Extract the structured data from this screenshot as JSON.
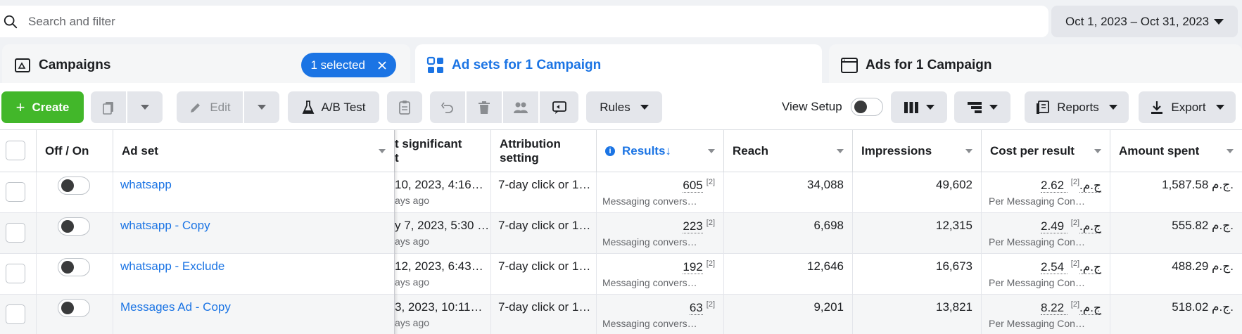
{
  "search": {
    "placeholder": "Search and filter"
  },
  "date_range": {
    "label": "Oct 1, 2023 – Oct 31, 2023"
  },
  "tabs": {
    "campaigns": {
      "label": "Campaigns",
      "selected_label": "1 selected"
    },
    "adsets": {
      "label": "Ad sets for 1 Campaign"
    },
    "ads": {
      "label": "Ads for 1 Campaign"
    }
  },
  "toolbar": {
    "create_label": "Create",
    "edit_label": "Edit",
    "abtest_label": "A/B Test",
    "rules_label": "Rules",
    "view_setup_label": "View Setup",
    "reports_label": "Reports",
    "export_label": "Export"
  },
  "table": {
    "headers": {
      "off_on": "Off / On",
      "ad_set": "Ad set",
      "last_significant_line1": "t significant",
      "last_significant_line2": "t",
      "attribution_line1": "Attribution",
      "attribution_line2": "setting",
      "results": "Results",
      "results_sort": "↓",
      "reach": "Reach",
      "impressions": "Impressions",
      "cost_per_result": "Cost per result",
      "amount_spent": "Amount spent"
    },
    "rows": [
      {
        "name": "whatsapp",
        "last_edit": "10, 2023, 4:16…",
        "last_edit_sub": "ays ago",
        "attribution": "7-day click or 1…",
        "results": "605",
        "results_sup": "[2]",
        "results_sub": "Messaging convers…",
        "reach": "34,088",
        "impressions": "49,602",
        "cost": "2.62 ج.م.",
        "cost_sup": "[2]",
        "cost_sub": "Per Messaging Con…",
        "spent": "1,587.58 ج.م."
      },
      {
        "name": "whatsapp - Copy",
        "last_edit": "y 7, 2023, 5:30 …",
        "last_edit_sub": "ays ago",
        "attribution": "7-day click or 1…",
        "results": "223",
        "results_sup": "[2]",
        "results_sub": "Messaging convers…",
        "reach": "6,698",
        "impressions": "12,315",
        "cost": "2.49 ج.م.",
        "cost_sup": "[2]",
        "cost_sub": "Per Messaging Con…",
        "spent": "555.82 ج.م."
      },
      {
        "name": "whatsapp - Exclude",
        "last_edit": "12, 2023, 6:43…",
        "last_edit_sub": "ays ago",
        "attribution": "7-day click or 1…",
        "results": "192",
        "results_sup": "[2]",
        "results_sub": "Messaging convers…",
        "reach": "12,646",
        "impressions": "16,673",
        "cost": "2.54 ج.م.",
        "cost_sup": "[2]",
        "cost_sub": "Per Messaging Con…",
        "spent": "488.29 ج.م."
      },
      {
        "name": "Messages Ad - Copy",
        "last_edit": "3, 2023, 10:11…",
        "last_edit_sub": "ays ago",
        "attribution": "7-day click or 1…",
        "results": "63",
        "results_sup": "[2]",
        "results_sub": "Messaging convers…",
        "reach": "9,201",
        "impressions": "13,821",
        "cost": "8.22 ج.م.",
        "cost_sup": "[2]",
        "cost_sub": "Per Messaging Con…",
        "spent": "518.02 ج.م."
      }
    ]
  },
  "colors": {
    "accent": "#1b74e4",
    "create": "#42b72a"
  }
}
